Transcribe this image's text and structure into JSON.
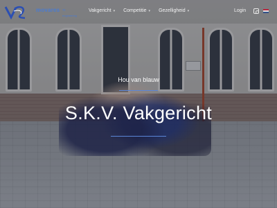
{
  "navbar": {
    "partner": {
      "name": "movares",
      "mark": "≈",
      "sub": "engineering"
    },
    "menu": [
      {
        "label": "Vakgericht"
      },
      {
        "label": "Competitie"
      },
      {
        "label": "Gezelligheid"
      }
    ],
    "login_label": "Login",
    "icons": {
      "dropdown": "chevron-down-icon",
      "social": "instagram-icon",
      "language": "dutch-flag-icon"
    }
  },
  "hero": {
    "kicker": "Hou van blauw",
    "title": "S.K.V. Vakgericht"
  },
  "colors": {
    "accent": "#5b86d8",
    "logo_blue": "#2b4fb3",
    "nav_text": "#f2f2f2"
  }
}
